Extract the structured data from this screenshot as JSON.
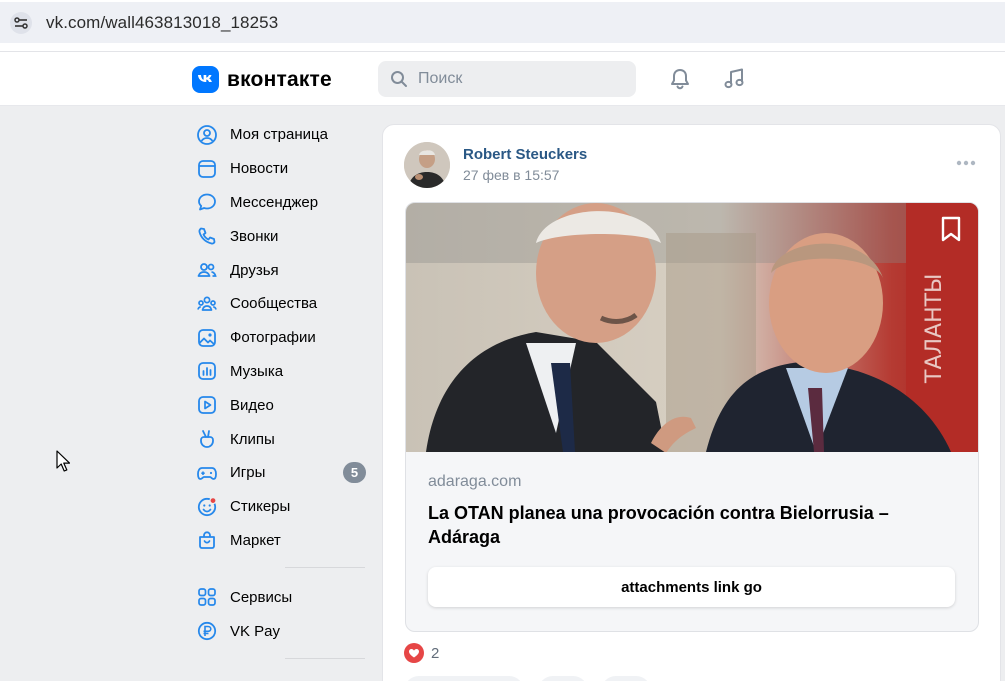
{
  "browser": {
    "url": "vk.com/wall463813018_18253"
  },
  "header": {
    "logo_text": "вконтакте",
    "search_placeholder": "Поиск",
    "brand_color": "#0077ff"
  },
  "sidebar": {
    "items": [
      {
        "label": "Моя страница",
        "icon": "user-circle-icon"
      },
      {
        "label": "Новости",
        "icon": "news-icon"
      },
      {
        "label": "Мессенджер",
        "icon": "message-icon"
      },
      {
        "label": "Звонки",
        "icon": "phone-icon"
      },
      {
        "label": "Друзья",
        "icon": "friends-icon"
      },
      {
        "label": "Сообщества",
        "icon": "communities-icon"
      },
      {
        "label": "Фотографии",
        "icon": "photo-icon"
      },
      {
        "label": "Музыка",
        "icon": "music-icon"
      },
      {
        "label": "Видео",
        "icon": "video-icon"
      },
      {
        "label": "Клипы",
        "icon": "clips-icon"
      },
      {
        "label": "Игры",
        "icon": "games-icon",
        "badge": "5"
      },
      {
        "label": "Стикеры",
        "icon": "stickers-icon"
      },
      {
        "label": "Маркет",
        "icon": "market-icon"
      }
    ],
    "secondary": [
      {
        "label": "Сервисы",
        "icon": "services-icon"
      },
      {
        "label": "VK Pay",
        "icon": "vkpay-icon"
      }
    ]
  },
  "post": {
    "author": "Robert Steuckers",
    "date": "27 фев в 15:57",
    "attachment": {
      "domain": "adaraga.com",
      "title": "La OTAN planea una provocación contra Bielorrusia – Adáraga",
      "button_label": "attachments link go",
      "photo_description": "news-photo"
    },
    "likes": "2"
  }
}
